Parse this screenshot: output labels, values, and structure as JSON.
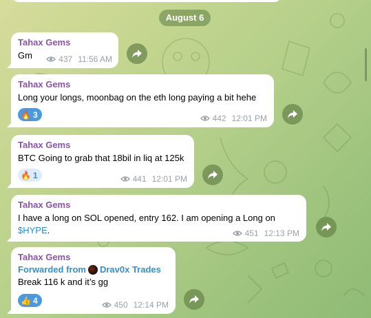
{
  "date_label": "August 6",
  "messages": [
    {
      "sender": "Tahax Gems",
      "text": "Gm",
      "views": "437",
      "time": "11:56 AM"
    },
    {
      "sender": "Tahax Gems",
      "text": "Long your longs, moonbag on the eth long paying a bit hehe",
      "reaction": {
        "emoji": "🔥",
        "count": "3"
      },
      "views": "442",
      "time": "12:01 PM"
    },
    {
      "sender": "Tahax Gems",
      "text": "BTC Going to grab that 18bil in liq at 125k",
      "reaction": {
        "emoji": "🔥",
        "count": "1"
      },
      "views": "441",
      "time": "12:01 PM"
    },
    {
      "sender": "Tahax Gems",
      "text_prefix": "I have a long on SOL opened, entry 162. I am opening a Long on",
      "text_link": "$HYPE",
      "text_suffix": ".",
      "views": "451",
      "time": "12:13 PM"
    },
    {
      "sender": "Tahax Gems",
      "forwarded_label": "Forwarded from",
      "forwarded_source": "Drav0x Trades",
      "text": "Break 116 k and it’s gg",
      "reaction": {
        "emoji": "👍",
        "count": "4"
      },
      "views": "450",
      "time": "12:14 PM"
    }
  ],
  "colors": {
    "sender": "#8b53a8",
    "link": "#2a8bd3",
    "reaction_active": "#4a9ae2",
    "reaction_inactive": "#dcecfa",
    "meta": "#9aa2a8"
  },
  "icons": {
    "views": "eye-icon",
    "share": "share-arrow-icon"
  }
}
